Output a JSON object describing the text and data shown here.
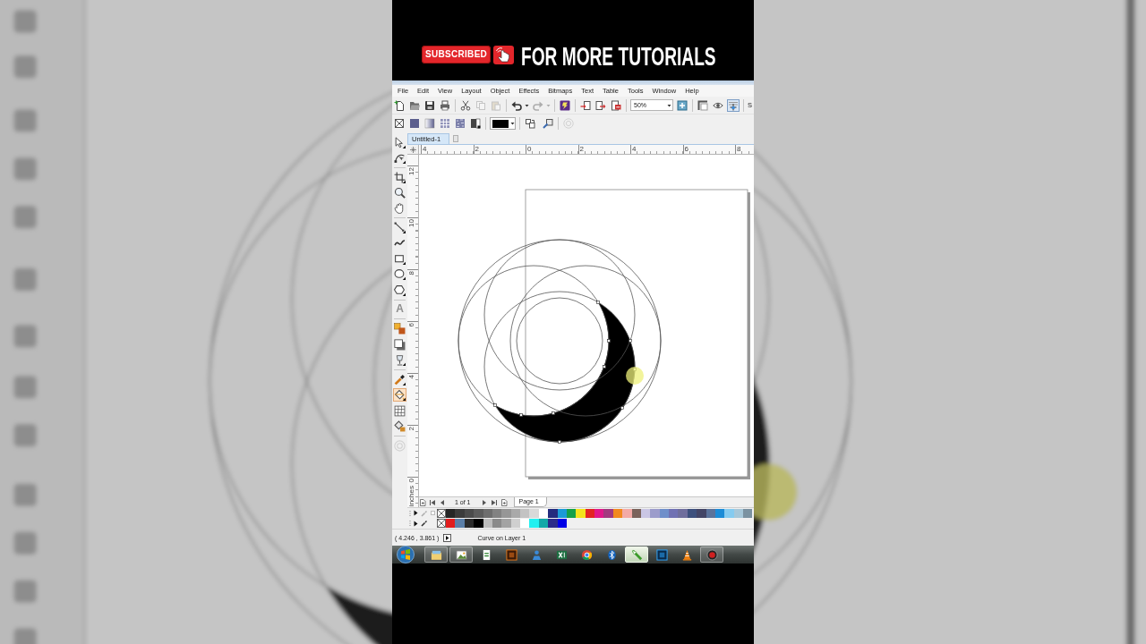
{
  "banner": {
    "badge": "SUBSCRIBED",
    "headline": "FOR MORE TUTORIALS"
  },
  "menu_bar": {
    "items": [
      "File",
      "Edit",
      "View",
      "Layout",
      "Object",
      "Effects",
      "Bitmaps",
      "Text",
      "Table",
      "Tools",
      "Window",
      "Help"
    ]
  },
  "standard_toolbar": {
    "groups_before_zoom": [
      [
        {
          "kind": "new",
          "disabled": false,
          "pressed": false
        },
        {
          "kind": "open",
          "disabled": false,
          "pressed": false
        },
        {
          "kind": "save",
          "disabled": false,
          "pressed": false
        },
        {
          "kind": "print",
          "disabled": false,
          "pressed": false
        }
      ],
      [
        {
          "kind": "cut",
          "disabled": false,
          "pressed": false
        },
        {
          "kind": "copy",
          "disabled": true,
          "pressed": false
        },
        {
          "kind": "paste",
          "disabled": true,
          "pressed": false
        }
      ],
      [
        {
          "kind": "undo",
          "disabled": false,
          "pressed": false
        },
        {
          "kind": "redo",
          "disabled": true,
          "pressed": false
        }
      ],
      [
        {
          "kind": "launcher",
          "disabled": false,
          "pressed": false
        }
      ],
      [
        {
          "kind": "import",
          "disabled": false,
          "pressed": false
        },
        {
          "kind": "export",
          "disabled": false,
          "pressed": false
        },
        {
          "kind": "publish",
          "disabled": false,
          "pressed": false
        }
      ]
    ],
    "zoom": {
      "value": "50%"
    },
    "groups_after_zoom": [
      [
        {
          "kind": "zoom-tool",
          "disabled": false,
          "pressed": false
        }
      ],
      [
        {
          "kind": "rulers",
          "disabled": false,
          "pressed": false
        },
        {
          "kind": "view",
          "disabled": false,
          "pressed": false
        },
        {
          "kind": "snap",
          "disabled": false,
          "pressed": true
        }
      ]
    ],
    "trailing_text": "S"
  },
  "property_bar": {
    "fill_types": [
      {
        "kind": "none",
        "disabled": false
      },
      {
        "kind": "uniform",
        "disabled": false
      },
      {
        "kind": "fountain",
        "disabled": false
      },
      {
        "kind": "pattern",
        "disabled": false
      },
      {
        "kind": "texture",
        "disabled": false
      },
      {
        "kind": "postscript",
        "disabled": false
      }
    ],
    "color_picker": {
      "color": "#000000"
    },
    "tools": [
      {
        "kind": "copy-fill",
        "disabled": false
      },
      {
        "kind": "edit-fill",
        "disabled": false
      }
    ],
    "extra": [
      {
        "kind": "circle",
        "disabled": true
      }
    ]
  },
  "toolbox": {
    "groups": [
      [
        {
          "kind": "pick",
          "selected": false,
          "disabled": false
        },
        {
          "kind": "shape",
          "selected": false,
          "disabled": false
        }
      ],
      [
        {
          "kind": "crop",
          "selected": false,
          "disabled": false
        },
        {
          "kind": "zoom",
          "selected": false,
          "disabled": false
        },
        {
          "kind": "pan",
          "selected": false,
          "disabled": false
        }
      ],
      [
        {
          "kind": "freehand",
          "selected": false,
          "disabled": false
        },
        {
          "kind": "smart",
          "selected": false,
          "disabled": false
        },
        {
          "kind": "rectangle",
          "selected": false,
          "disabled": false
        },
        {
          "kind": "ellipse",
          "selected": false,
          "disabled": false
        },
        {
          "kind": "polygon",
          "selected": false,
          "disabled": false
        }
      ],
      [
        {
          "kind": "text",
          "glyph": "A",
          "selected": false,
          "disabled": false
        }
      ],
      [
        {
          "kind": "blend",
          "selected": false,
          "disabled": false
        },
        {
          "kind": "shadow",
          "selected": false,
          "disabled": false
        },
        {
          "kind": "transparency",
          "selected": false,
          "disabled": false
        }
      ],
      [
        {
          "kind": "eyedropper",
          "selected": false,
          "disabled": false
        },
        {
          "kind": "interactive-fill",
          "selected": true,
          "disabled": false
        },
        {
          "kind": "mesh",
          "selected": false,
          "disabled": false
        },
        {
          "kind": "smart-fill",
          "selected": false,
          "disabled": false
        }
      ],
      [
        {
          "kind": "circle",
          "selected": false,
          "disabled": true
        }
      ]
    ]
  },
  "document_tabs": [
    {
      "label": "Untitled-1",
      "selected": true
    }
  ],
  "rulers": {
    "horizontal": [
      "4",
      "2",
      "0",
      "2",
      "4",
      "6",
      "8"
    ],
    "vertical": [
      "12",
      "10",
      "8",
      "6",
      "4",
      "2",
      "0"
    ],
    "unit": "inches"
  },
  "page_navigator": {
    "indicator": "1 of 1",
    "pages": [
      {
        "label": "Page 1",
        "selected": true
      }
    ]
  },
  "palette": {
    "rows": [
      {
        "picker_disabled": true,
        "lock_box": true,
        "swatches": [
          {
            "color": "#262626"
          },
          {
            "color": "#3b3b3b"
          },
          {
            "color": "#4b4b4b"
          },
          {
            "color": "#5c5c5c"
          },
          {
            "color": "#6e6e6e"
          },
          {
            "color": "#828282"
          },
          {
            "color": "#969696"
          },
          {
            "color": "#a9a9a9"
          },
          {
            "color": "#c3c3c3"
          },
          {
            "color": "#d9d9d9"
          },
          {
            "color": "#ffffff"
          },
          {
            "color": "#242c7e"
          },
          {
            "color": "#1b9ad6"
          },
          {
            "color": "#15a048"
          },
          {
            "color": "#f3e31c"
          },
          {
            "color": "#e32322"
          },
          {
            "color": "#e1178a"
          },
          {
            "color": "#a2397f"
          },
          {
            "color": "#f2891f"
          },
          {
            "color": "#f3aaa6"
          },
          {
            "color": "#7a635b"
          },
          {
            "color": "#cac6e4"
          },
          {
            "color": "#9c9ccb"
          },
          {
            "color": "#6f8fca"
          },
          {
            "color": "#7071b3"
          },
          {
            "color": "#6f6e9d"
          },
          {
            "color": "#3d507d"
          },
          {
            "color": "#434566"
          },
          {
            "color": "#5b739b"
          },
          {
            "color": "#1c8cd7"
          },
          {
            "color": "#85cbf0"
          },
          {
            "color": "#a6c7d9"
          },
          {
            "color": "#7b92a1"
          }
        ]
      },
      {
        "picker_disabled": false,
        "lock_box": false,
        "swatches": [
          {
            "color": "#e11d1d"
          },
          {
            "color": "#5b7fa8"
          },
          {
            "color": "#2b2b2b"
          },
          {
            "color": "#000000"
          },
          {
            "color": "#bcbcbc"
          },
          {
            "color": "#8a8a8a"
          },
          {
            "color": "#a3a3a3"
          },
          {
            "color": "#cfcfcf"
          },
          {
            "color": "#ffffff"
          },
          {
            "color": "#22f0f0"
          },
          {
            "color": "#12a8a8"
          },
          {
            "color": "#2b2b88"
          },
          {
            "color": "#0000e6"
          }
        ]
      }
    ]
  },
  "status_bar": {
    "coordinates": "( 4.246 , 3.861 )",
    "object_info": "Curve on Layer 1"
  },
  "taskbar": {
    "apps": [
      {
        "kind": "folder",
        "running": true,
        "active": false
      },
      {
        "kind": "photo",
        "running": true,
        "active": false
      },
      {
        "kind": "document",
        "running": false,
        "active": false
      },
      {
        "kind": "square-tile",
        "running": false,
        "active": false
      },
      {
        "kind": "person",
        "running": false,
        "active": false
      },
      {
        "kind": "spreadsheet",
        "running": false,
        "active": false
      },
      {
        "kind": "browser",
        "running": false,
        "active": false
      },
      {
        "kind": "bluetooth",
        "running": false,
        "active": false
      },
      {
        "kind": "vector-app",
        "running": true,
        "active": true
      },
      {
        "kind": "framed-tile",
        "running": false,
        "active": false
      },
      {
        "kind": "cone",
        "running": false,
        "active": false
      },
      {
        "kind": "recorder",
        "running": true,
        "active": false
      }
    ]
  }
}
